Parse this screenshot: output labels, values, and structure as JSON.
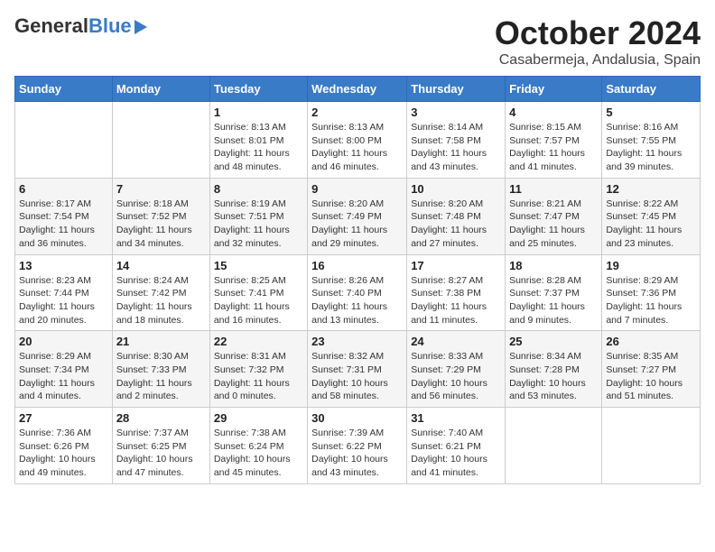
{
  "logo": {
    "general": "General",
    "blue": "Blue"
  },
  "title": "October 2024",
  "location": "Casabermeja, Andalusia, Spain",
  "weekdays": [
    "Sunday",
    "Monday",
    "Tuesday",
    "Wednesday",
    "Thursday",
    "Friday",
    "Saturday"
  ],
  "weeks": [
    [
      {
        "day": "",
        "sunrise": "",
        "sunset": "",
        "daylight": ""
      },
      {
        "day": "",
        "sunrise": "",
        "sunset": "",
        "daylight": ""
      },
      {
        "day": "1",
        "sunrise": "Sunrise: 8:13 AM",
        "sunset": "Sunset: 8:01 PM",
        "daylight": "Daylight: 11 hours and 48 minutes."
      },
      {
        "day": "2",
        "sunrise": "Sunrise: 8:13 AM",
        "sunset": "Sunset: 8:00 PM",
        "daylight": "Daylight: 11 hours and 46 minutes."
      },
      {
        "day": "3",
        "sunrise": "Sunrise: 8:14 AM",
        "sunset": "Sunset: 7:58 PM",
        "daylight": "Daylight: 11 hours and 43 minutes."
      },
      {
        "day": "4",
        "sunrise": "Sunrise: 8:15 AM",
        "sunset": "Sunset: 7:57 PM",
        "daylight": "Daylight: 11 hours and 41 minutes."
      },
      {
        "day": "5",
        "sunrise": "Sunrise: 8:16 AM",
        "sunset": "Sunset: 7:55 PM",
        "daylight": "Daylight: 11 hours and 39 minutes."
      }
    ],
    [
      {
        "day": "6",
        "sunrise": "Sunrise: 8:17 AM",
        "sunset": "Sunset: 7:54 PM",
        "daylight": "Daylight: 11 hours and 36 minutes."
      },
      {
        "day": "7",
        "sunrise": "Sunrise: 8:18 AM",
        "sunset": "Sunset: 7:52 PM",
        "daylight": "Daylight: 11 hours and 34 minutes."
      },
      {
        "day": "8",
        "sunrise": "Sunrise: 8:19 AM",
        "sunset": "Sunset: 7:51 PM",
        "daylight": "Daylight: 11 hours and 32 minutes."
      },
      {
        "day": "9",
        "sunrise": "Sunrise: 8:20 AM",
        "sunset": "Sunset: 7:49 PM",
        "daylight": "Daylight: 11 hours and 29 minutes."
      },
      {
        "day": "10",
        "sunrise": "Sunrise: 8:20 AM",
        "sunset": "Sunset: 7:48 PM",
        "daylight": "Daylight: 11 hours and 27 minutes."
      },
      {
        "day": "11",
        "sunrise": "Sunrise: 8:21 AM",
        "sunset": "Sunset: 7:47 PM",
        "daylight": "Daylight: 11 hours and 25 minutes."
      },
      {
        "day": "12",
        "sunrise": "Sunrise: 8:22 AM",
        "sunset": "Sunset: 7:45 PM",
        "daylight": "Daylight: 11 hours and 23 minutes."
      }
    ],
    [
      {
        "day": "13",
        "sunrise": "Sunrise: 8:23 AM",
        "sunset": "Sunset: 7:44 PM",
        "daylight": "Daylight: 11 hours and 20 minutes."
      },
      {
        "day": "14",
        "sunrise": "Sunrise: 8:24 AM",
        "sunset": "Sunset: 7:42 PM",
        "daylight": "Daylight: 11 hours and 18 minutes."
      },
      {
        "day": "15",
        "sunrise": "Sunrise: 8:25 AM",
        "sunset": "Sunset: 7:41 PM",
        "daylight": "Daylight: 11 hours and 16 minutes."
      },
      {
        "day": "16",
        "sunrise": "Sunrise: 8:26 AM",
        "sunset": "Sunset: 7:40 PM",
        "daylight": "Daylight: 11 hours and 13 minutes."
      },
      {
        "day": "17",
        "sunrise": "Sunrise: 8:27 AM",
        "sunset": "Sunset: 7:38 PM",
        "daylight": "Daylight: 11 hours and 11 minutes."
      },
      {
        "day": "18",
        "sunrise": "Sunrise: 8:28 AM",
        "sunset": "Sunset: 7:37 PM",
        "daylight": "Daylight: 11 hours and 9 minutes."
      },
      {
        "day": "19",
        "sunrise": "Sunrise: 8:29 AM",
        "sunset": "Sunset: 7:36 PM",
        "daylight": "Daylight: 11 hours and 7 minutes."
      }
    ],
    [
      {
        "day": "20",
        "sunrise": "Sunrise: 8:29 AM",
        "sunset": "Sunset: 7:34 PM",
        "daylight": "Daylight: 11 hours and 4 minutes."
      },
      {
        "day": "21",
        "sunrise": "Sunrise: 8:30 AM",
        "sunset": "Sunset: 7:33 PM",
        "daylight": "Daylight: 11 hours and 2 minutes."
      },
      {
        "day": "22",
        "sunrise": "Sunrise: 8:31 AM",
        "sunset": "Sunset: 7:32 PM",
        "daylight": "Daylight: 11 hours and 0 minutes."
      },
      {
        "day": "23",
        "sunrise": "Sunrise: 8:32 AM",
        "sunset": "Sunset: 7:31 PM",
        "daylight": "Daylight: 10 hours and 58 minutes."
      },
      {
        "day": "24",
        "sunrise": "Sunrise: 8:33 AM",
        "sunset": "Sunset: 7:29 PM",
        "daylight": "Daylight: 10 hours and 56 minutes."
      },
      {
        "day": "25",
        "sunrise": "Sunrise: 8:34 AM",
        "sunset": "Sunset: 7:28 PM",
        "daylight": "Daylight: 10 hours and 53 minutes."
      },
      {
        "day": "26",
        "sunrise": "Sunrise: 8:35 AM",
        "sunset": "Sunset: 7:27 PM",
        "daylight": "Daylight: 10 hours and 51 minutes."
      }
    ],
    [
      {
        "day": "27",
        "sunrise": "Sunrise: 7:36 AM",
        "sunset": "Sunset: 6:26 PM",
        "daylight": "Daylight: 10 hours and 49 minutes."
      },
      {
        "day": "28",
        "sunrise": "Sunrise: 7:37 AM",
        "sunset": "Sunset: 6:25 PM",
        "daylight": "Daylight: 10 hours and 47 minutes."
      },
      {
        "day": "29",
        "sunrise": "Sunrise: 7:38 AM",
        "sunset": "Sunset: 6:24 PM",
        "daylight": "Daylight: 10 hours and 45 minutes."
      },
      {
        "day": "30",
        "sunrise": "Sunrise: 7:39 AM",
        "sunset": "Sunset: 6:22 PM",
        "daylight": "Daylight: 10 hours and 43 minutes."
      },
      {
        "day": "31",
        "sunrise": "Sunrise: 7:40 AM",
        "sunset": "Sunset: 6:21 PM",
        "daylight": "Daylight: 10 hours and 41 minutes."
      },
      {
        "day": "",
        "sunrise": "",
        "sunset": "",
        "daylight": ""
      },
      {
        "day": "",
        "sunrise": "",
        "sunset": "",
        "daylight": ""
      }
    ]
  ]
}
